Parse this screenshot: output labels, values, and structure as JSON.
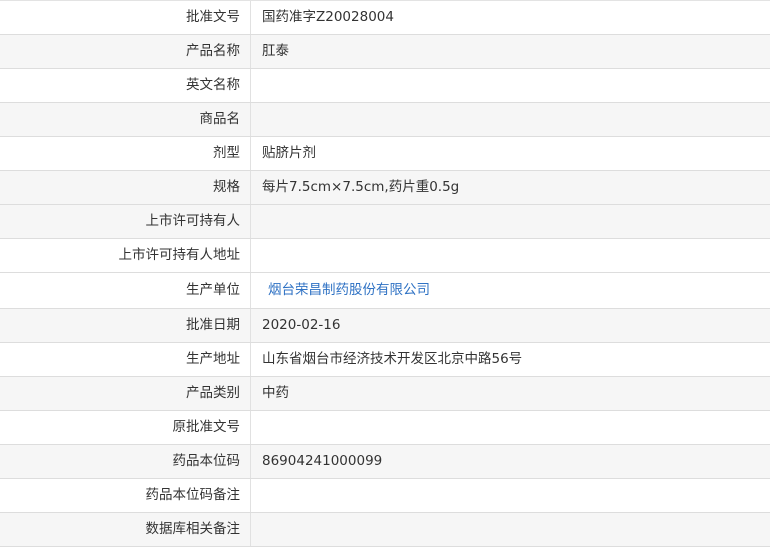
{
  "rows": [
    {
      "label": "批准文号",
      "value": "国药准字Z20028004",
      "link": false
    },
    {
      "label": "产品名称",
      "value": "肛泰",
      "link": false
    },
    {
      "label": "英文名称",
      "value": "",
      "link": false
    },
    {
      "label": "商品名",
      "value": "",
      "link": false
    },
    {
      "label": "剂型",
      "value": "贴脐片剂",
      "link": false
    },
    {
      "label": "规格",
      "value": "每片7.5cm×7.5cm,药片重0.5g",
      "link": false
    },
    {
      "label": "上市许可持有人",
      "value": "",
      "link": false
    },
    {
      "label": "上市许可持有人地址",
      "value": "",
      "link": false
    },
    {
      "label": "生产单位",
      "value": "烟台荣昌制药股份有限公司",
      "link": true
    },
    {
      "label": "批准日期",
      "value": "2020-02-16",
      "link": false
    },
    {
      "label": "生产地址",
      "value": "山东省烟台市经济技术开发区北京中路56号",
      "link": false
    },
    {
      "label": "产品类别",
      "value": "中药",
      "link": false
    },
    {
      "label": "原批准文号",
      "value": "",
      "link": false
    },
    {
      "label": "药品本位码",
      "value": "86904241000099",
      "link": false
    },
    {
      "label": "药品本位码备注",
      "value": "",
      "link": false
    },
    {
      "label": "数据库相关备注",
      "value": "",
      "link": false
    }
  ],
  "colors": {
    "link": "#2f72c4",
    "row_alt_bg": "#f6f6f6",
    "border": "#dddddd"
  }
}
